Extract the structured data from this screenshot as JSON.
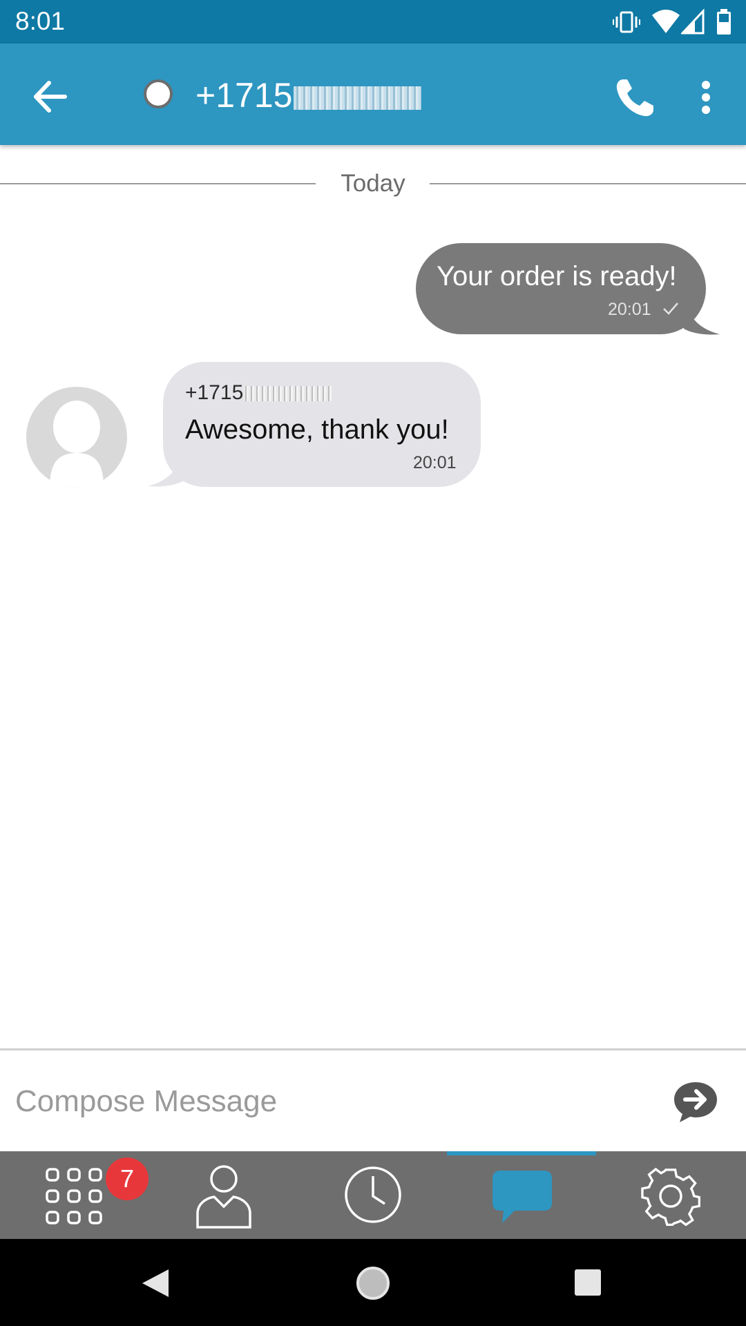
{
  "status_bar": {
    "time": "8:01"
  },
  "header": {
    "contact_name": "+1715"
  },
  "conversation": {
    "date_divider": "Today",
    "messages": [
      {
        "direction": "outgoing",
        "text": "Your order is ready!",
        "time": "20:01",
        "status": "delivered"
      },
      {
        "direction": "incoming",
        "sender": "+1715",
        "text": "Awesome, thank you!",
        "time": "20:01"
      }
    ]
  },
  "compose": {
    "placeholder": "Compose Message"
  },
  "bottom_nav": {
    "items": [
      "dialpad-icon",
      "contacts-icon",
      "recents-icon",
      "messages-icon",
      "settings-icon"
    ],
    "active": "messages",
    "badge_count": "7"
  },
  "colors": {
    "status_bar": "#0e79a4",
    "app_bar": "#2d96c1",
    "outgoing_bubble": "#7a7a7a",
    "incoming_bubble": "#e4e4e8",
    "nav_bar": "#6e6e6e",
    "badge": "#e8373a"
  }
}
